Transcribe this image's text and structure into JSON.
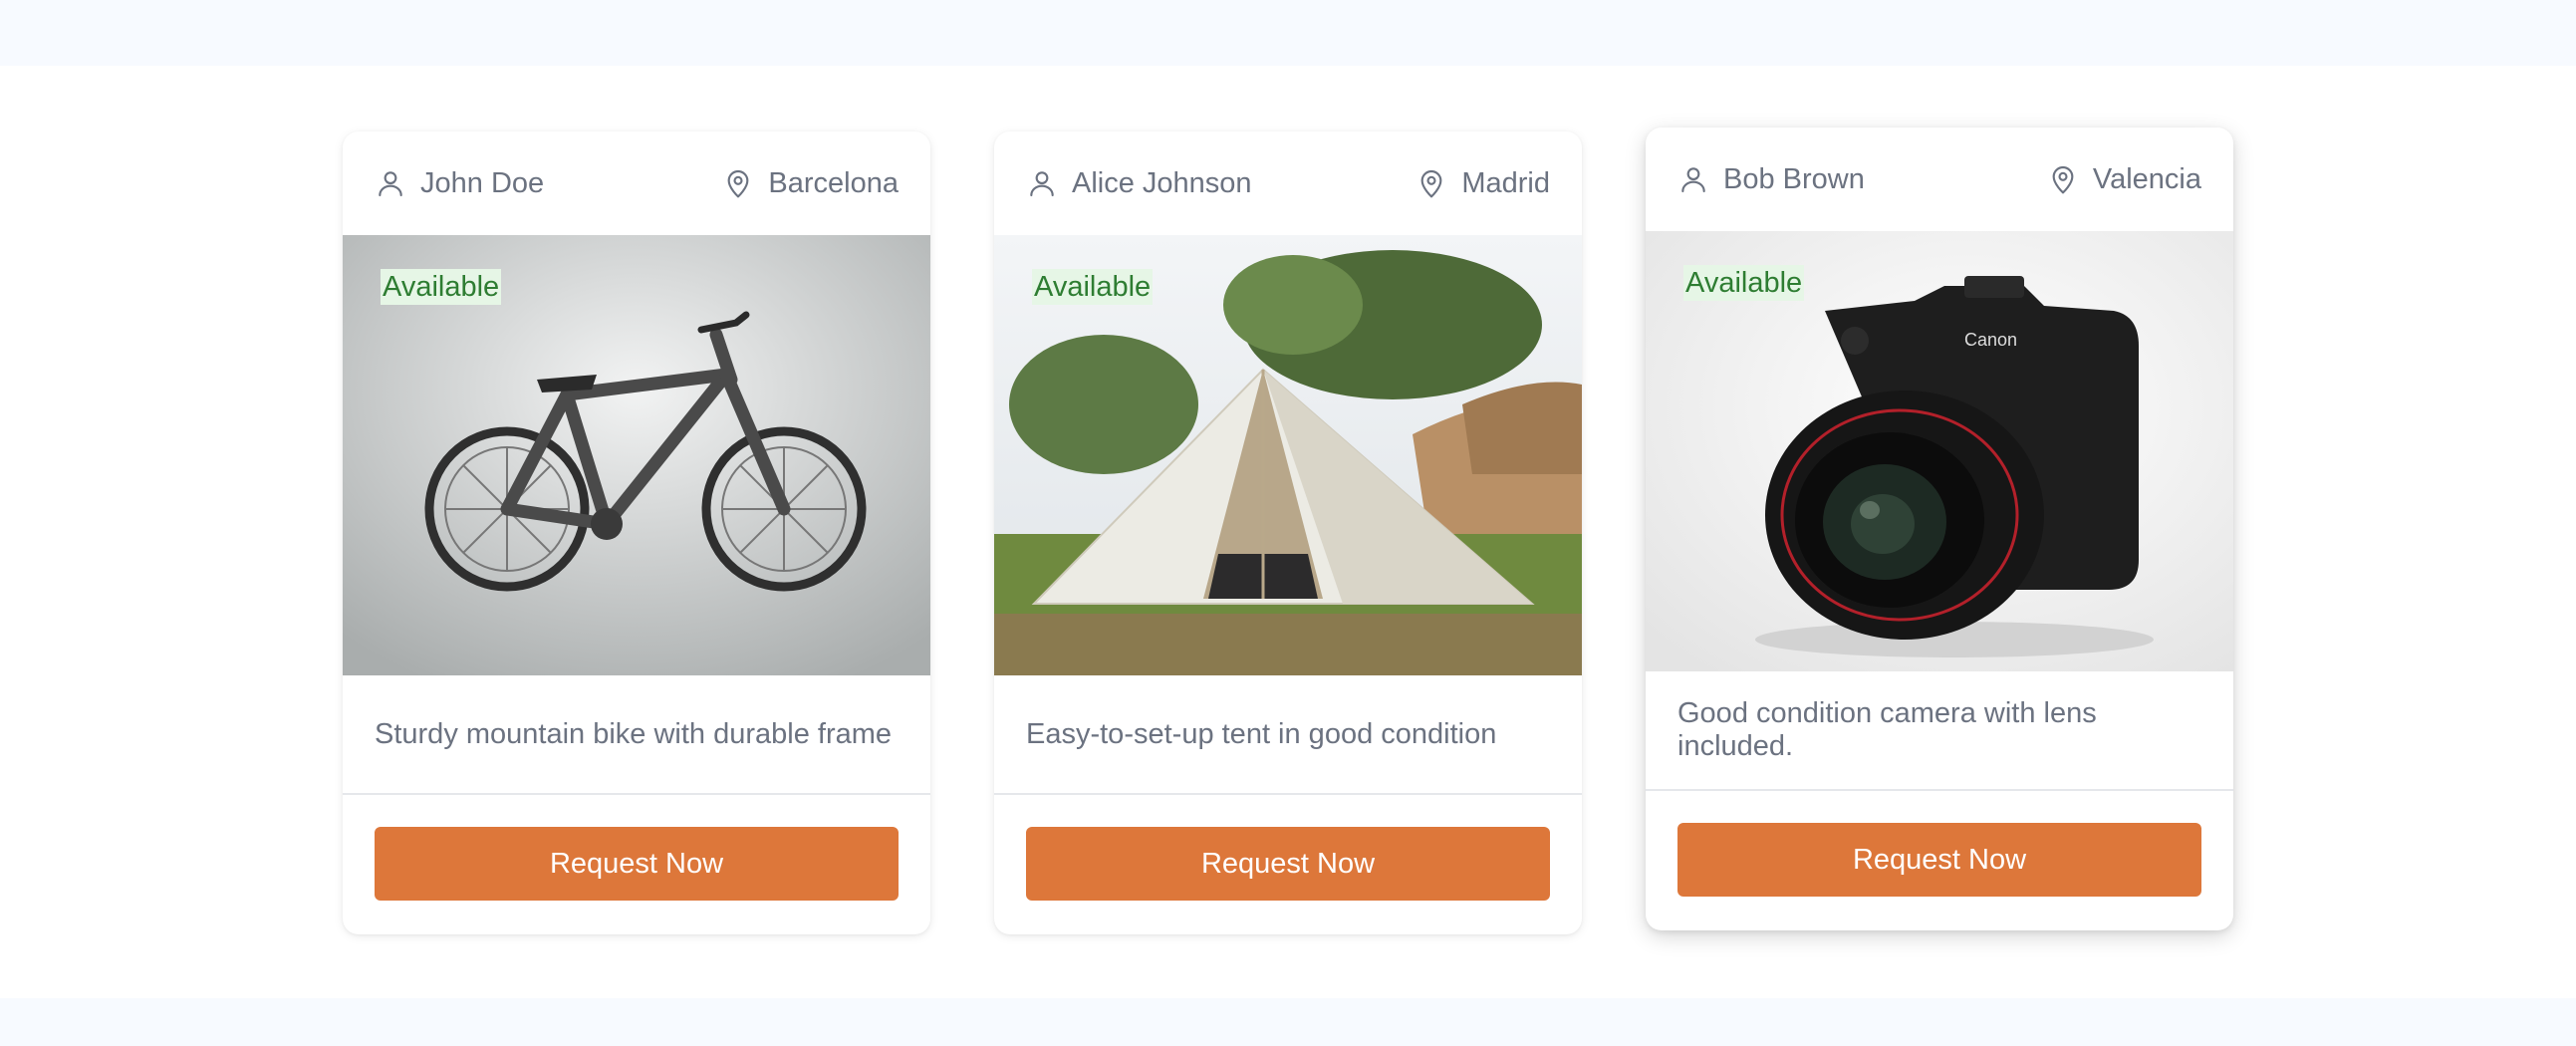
{
  "cards": [
    {
      "owner": "John Doe",
      "location": "Barcelona",
      "status": "Available",
      "description": "Sturdy mountain bike with durable frame",
      "button_label": "Request Now",
      "image": "mountain-bike"
    },
    {
      "owner": "Alice Johnson",
      "location": "Madrid",
      "status": "Available",
      "description": "Easy-to-set-up tent in good condition",
      "button_label": "Request Now",
      "image": "camping-tent"
    },
    {
      "owner": "Bob Brown",
      "location": "Valencia",
      "status": "Available",
      "description": "Good condition camera with lens included.",
      "button_label": "Request Now",
      "image": "dslr-camera"
    }
  ],
  "colors": {
    "accent": "#dd773a",
    "badge_bg": "#e6f6e6",
    "badge_text": "#2e7d32",
    "muted_text": "#6b7280",
    "page_band": "#f7faff"
  },
  "icons": {
    "owner": "user-icon",
    "location": "map-pin-icon"
  }
}
